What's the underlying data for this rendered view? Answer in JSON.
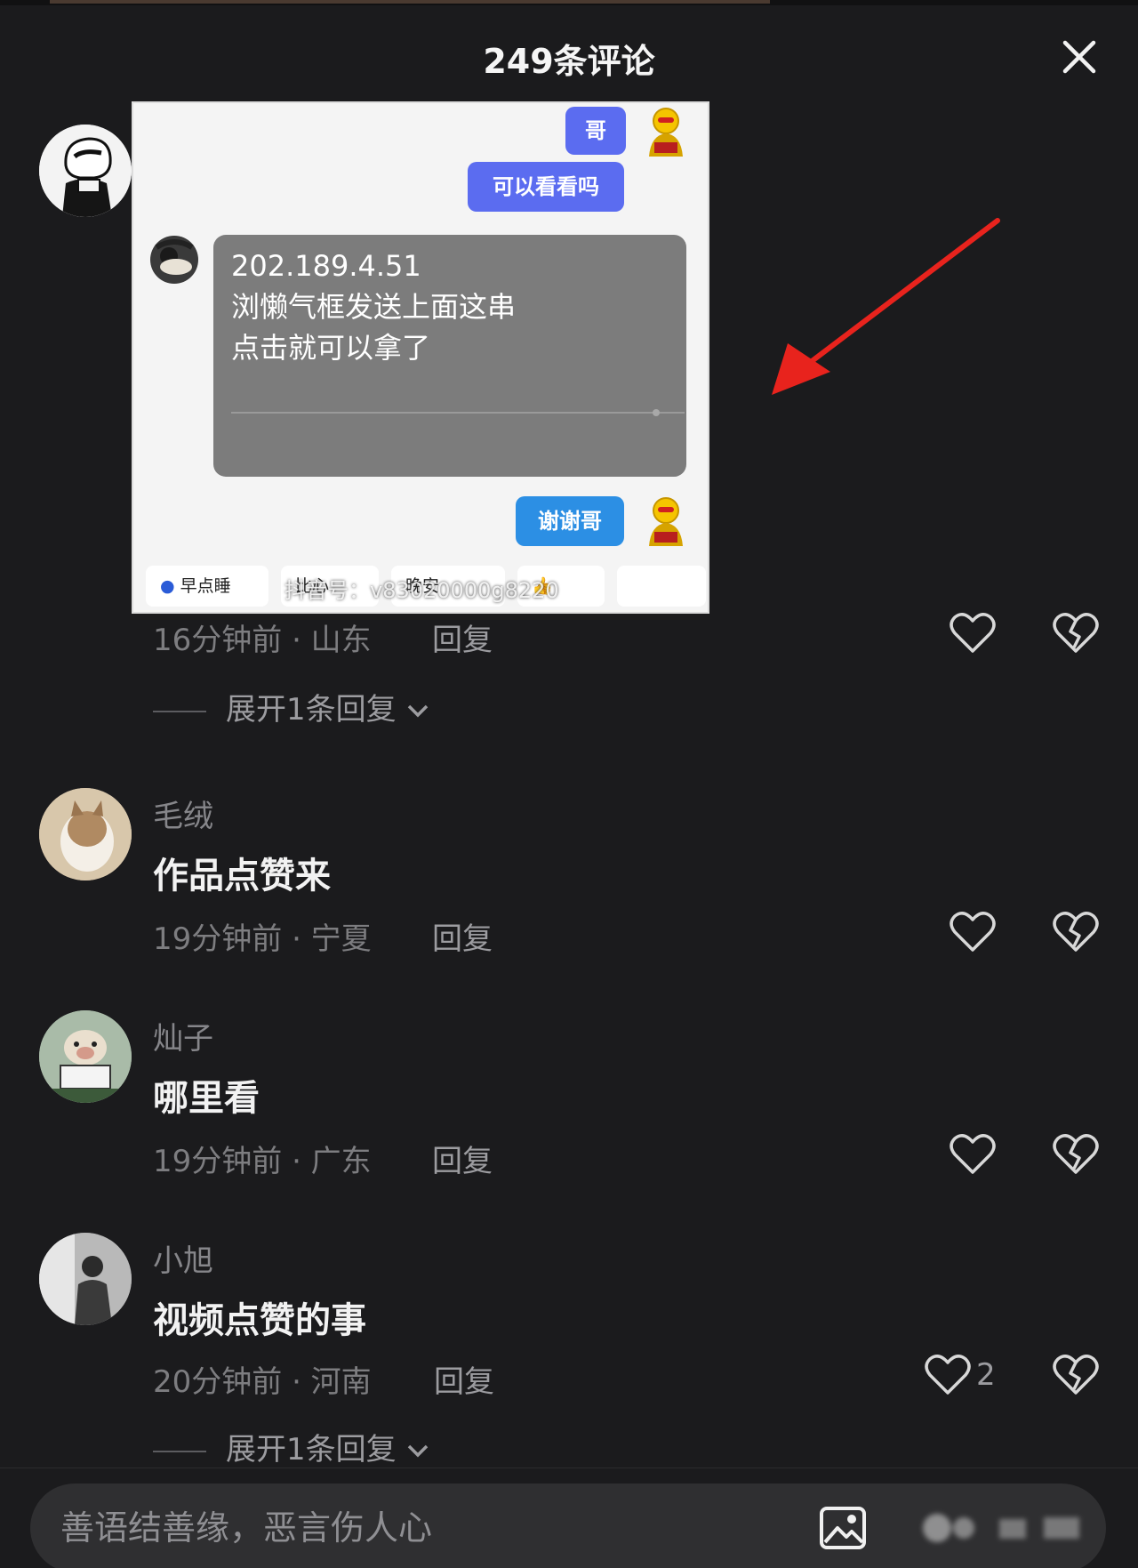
{
  "header": {
    "title": "249条评论"
  },
  "screenshot": {
    "msg1": "哥",
    "msg2": "可以看看吗",
    "reply_lines": [
      "202.189.4.51",
      "浏懒气框发送上面这串",
      "点击就可以拿了"
    ],
    "msg3": "谢谢哥",
    "chips": [
      "早点睡",
      "比心",
      "晚安",
      "👍"
    ],
    "watermark": "抖音号：v83020000g8220"
  },
  "comments": [
    {
      "username": "",
      "text": "",
      "meta": "16分钟前 · 山东",
      "reply": "回复",
      "expand": "展开1条回复",
      "likes": ""
    },
    {
      "username": "毛绒",
      "text": "作品点赞来",
      "meta": "19分钟前 · 宁夏",
      "reply": "回复",
      "expand": "",
      "likes": ""
    },
    {
      "username": "灿子",
      "text": "哪里看",
      "meta": "19分钟前 · 广东",
      "reply": "回复",
      "expand": "",
      "likes": ""
    },
    {
      "username": "小旭",
      "text": "视频点赞的事",
      "meta": "20分钟前 · 河南",
      "reply": "回复",
      "expand": "展开1条回复",
      "likes": "2"
    }
  ],
  "input": {
    "placeholder": "善语结善缘，恶言伤人心"
  },
  "colors": {
    "background": "#1b1b1d",
    "annotation_arrow": "#e8231d",
    "bubble_blue": "#5b6cf0",
    "bubble_cyan": "#2c8fe4"
  }
}
